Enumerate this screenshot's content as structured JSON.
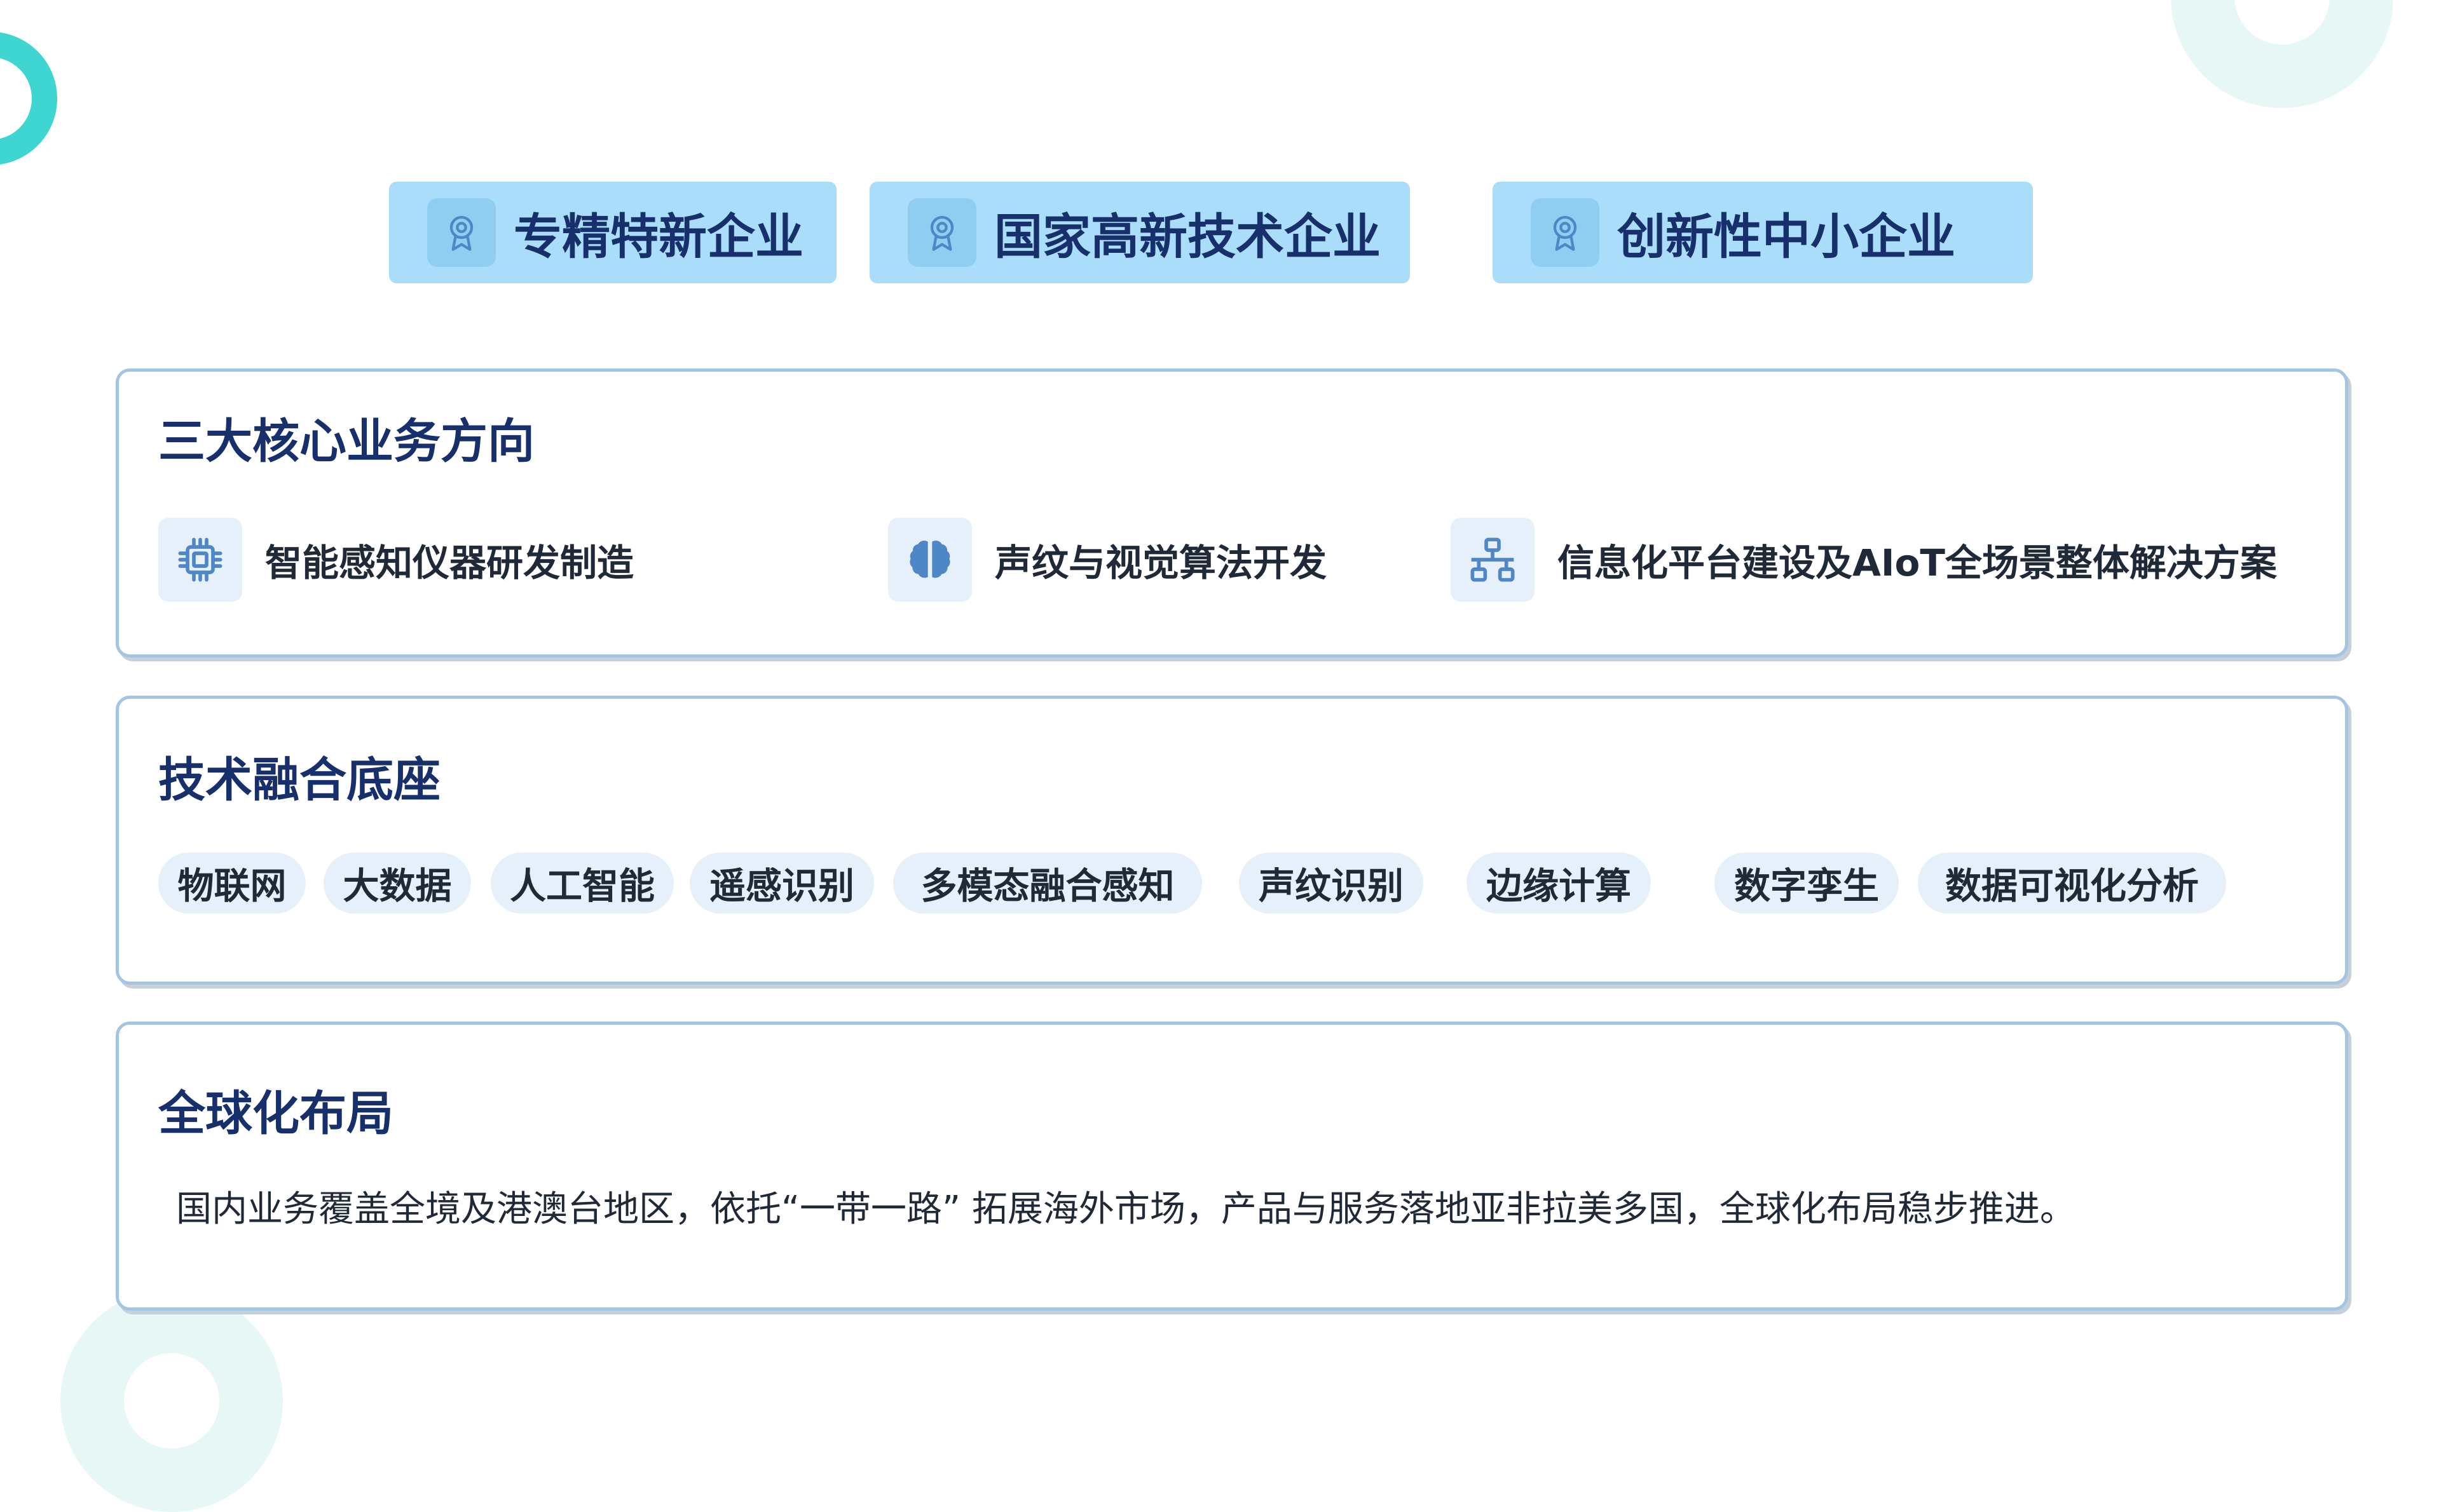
{
  "badges": [
    {
      "label": "专精特新企业",
      "icon": "award-ribbon-icon"
    },
    {
      "label": "国家高新技术企业",
      "icon": "award-ribbon-icon"
    },
    {
      "label": "创新性中小企业",
      "icon": "award-ribbon-icon"
    }
  ],
  "core_business": {
    "title": "三大核心业务方向",
    "items": [
      {
        "label": "智能感知仪器研发制造",
        "icon": "chip-icon"
      },
      {
        "label": "声纹与视觉算法开发",
        "icon": "brain-icon"
      },
      {
        "label": "信息化平台建设及AIoT全场景整体解决方案",
        "icon": "network-icon"
      }
    ]
  },
  "tech_base": {
    "title": "技术融合底座",
    "tags": [
      "物联网",
      "大数据",
      "人工智能",
      "遥感识别",
      "多模态融合感知",
      "声纹识别",
      "边缘计算",
      "数字孪生",
      "数据可视化分析"
    ]
  },
  "global": {
    "title": "全球化布局",
    "description": "国内业务覆盖全境及港澳台地区，依托“一带一路” 拓展海外市场，产品与服务落地亚非拉美多国，全球化布局稳步推进。"
  },
  "colors": {
    "badge_bg": "#a9ddf9",
    "title_navy": "#17306b",
    "card_border": "#a3c5e2",
    "tag_bg": "#e6f0fb",
    "accent_teal": "#3fd6d2"
  }
}
